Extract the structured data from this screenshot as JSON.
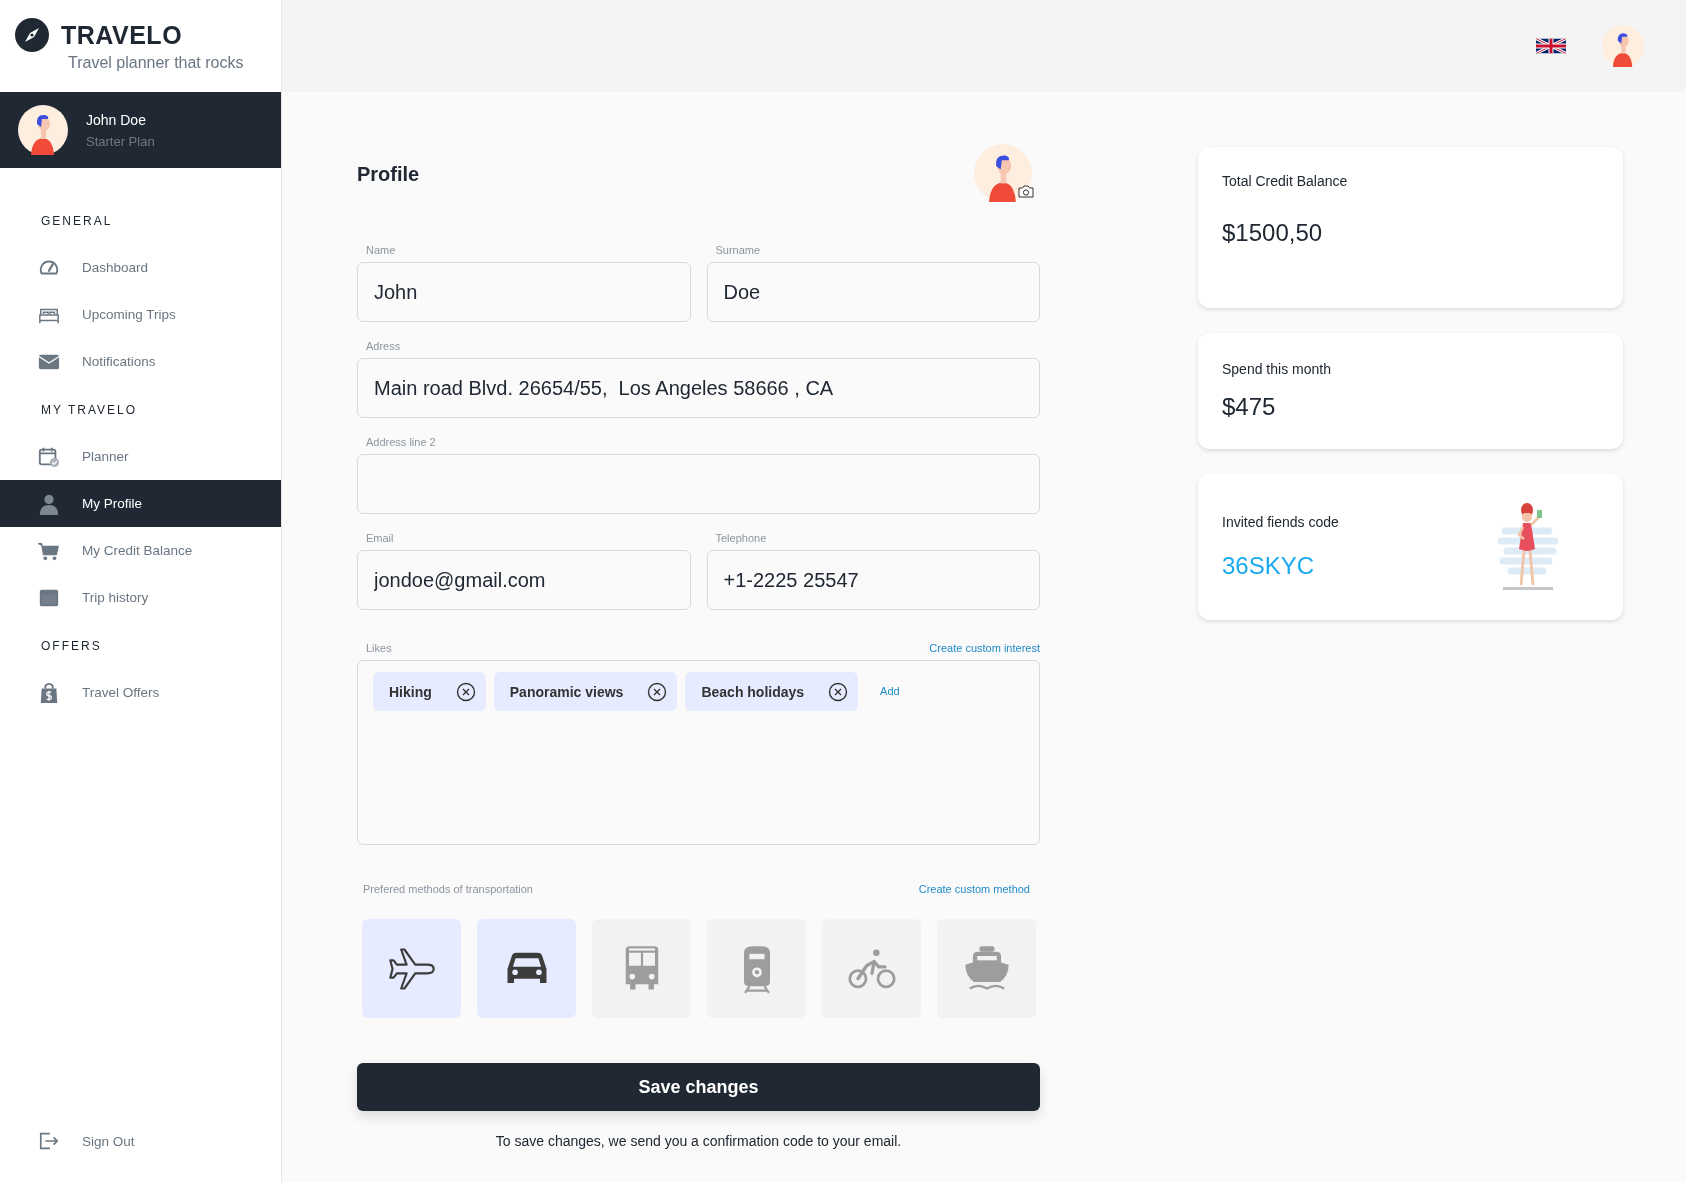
{
  "brand": {
    "name": "TRAVELO",
    "tagline": "Travel planner that rocks"
  },
  "user": {
    "name": "John  Doe",
    "plan": "Starter Plan"
  },
  "nav": [
    {
      "title": "GENERAL",
      "items": [
        {
          "label": "Dashboard",
          "kind": "gauge",
          "selected": false
        },
        {
          "label": "Upcoming Trips",
          "kind": "bed",
          "selected": false
        },
        {
          "label": "Notifications",
          "kind": "mail",
          "selected": false
        }
      ]
    },
    {
      "title": "MY TRAVELO",
      "items": [
        {
          "label": "Planner",
          "kind": "calendar",
          "selected": false
        },
        {
          "label": "My Profile",
          "kind": "person",
          "selected": true
        },
        {
          "label": "My Credit Balance",
          "kind": "cart",
          "selected": false
        },
        {
          "label": "Trip history",
          "kind": "window",
          "selected": false
        }
      ]
    },
    {
      "title": "OFFERS",
      "items": [
        {
          "label": "Travel Offers",
          "kind": "bag",
          "selected": false
        }
      ]
    }
  ],
  "signout": {
    "label": "Sign Out"
  },
  "profile": {
    "title": "Profile",
    "field_rows": [
      [
        {
          "label": "Name",
          "value": "John"
        },
        {
          "label": "Surname",
          "value": "Doe"
        }
      ],
      [
        {
          "label": "Adress",
          "value": "Main road Blvd. 26654/55,  Los Angeles 58666 , CA"
        }
      ],
      [
        {
          "label": "Address line 2"
        }
      ],
      [
        {
          "label": "Email",
          "value": "jondoe@gmail.com"
        },
        {
          "label": "Telephone",
          "value": "+1-2225 25547"
        }
      ]
    ],
    "likes": {
      "label": "Likes",
      "link": "Create custom interest",
      "tags": [
        "Hiking",
        "Panoramic views",
        "Beach holidays"
      ],
      "add": "Add"
    },
    "transport": {
      "label": "Prefered methods of  transportation",
      "link": "Create custom method",
      "methods": [
        {
          "kind": "plane",
          "selected": true
        },
        {
          "kind": "car",
          "selected": true
        },
        {
          "kind": "bus",
          "selected": false
        },
        {
          "kind": "train",
          "selected": false
        },
        {
          "kind": "bicycle",
          "selected": false
        },
        {
          "kind": "ship",
          "selected": false
        }
      ]
    },
    "save": "Save changes",
    "note": "To save changes, we send you a confirmation code to your email."
  },
  "cards": [
    {
      "kind": "amount",
      "label": "Total Credit Balance",
      "value": "$1500,50"
    },
    {
      "kind": "amount",
      "label": "Spend this month",
      "value": "$475"
    },
    {
      "kind": "code",
      "label": "Invited fiends code",
      "value": "36SKYC"
    }
  ]
}
